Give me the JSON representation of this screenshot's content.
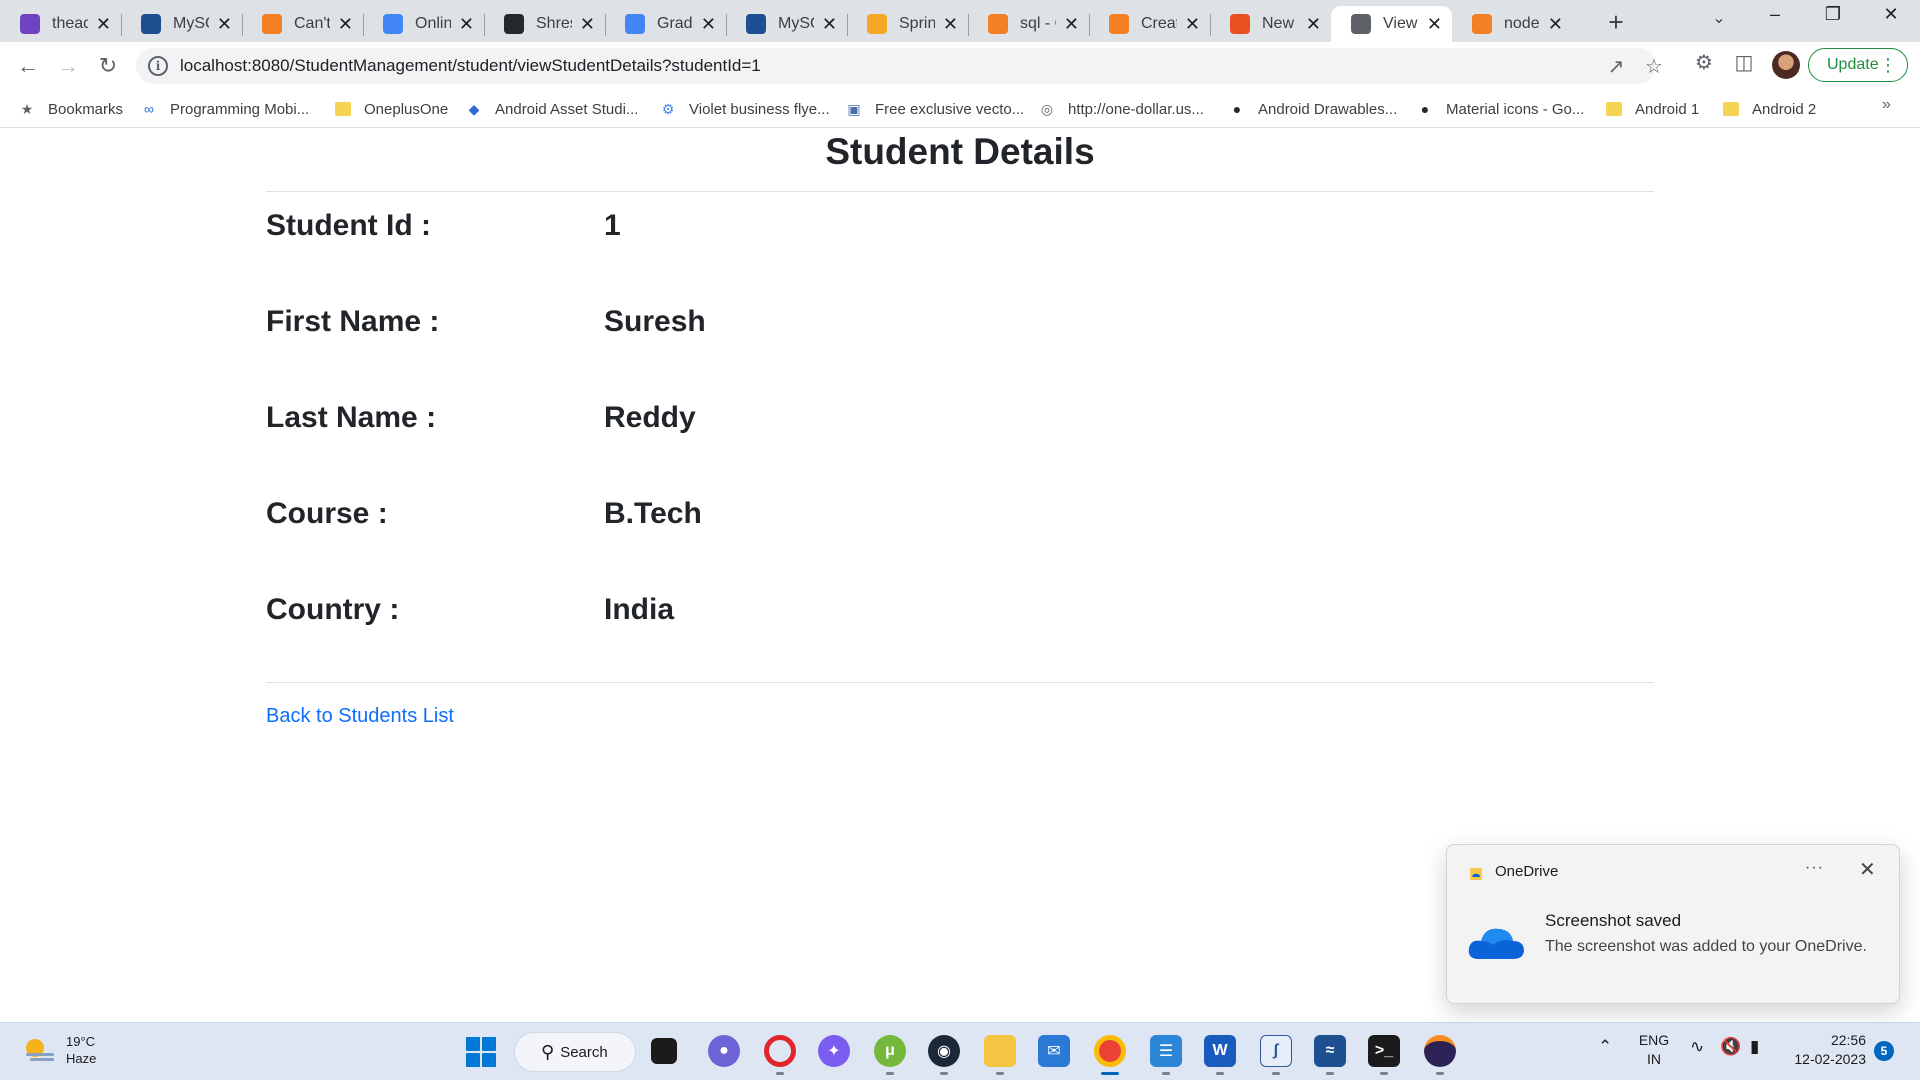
{
  "tabs": [
    {
      "title": "thead",
      "icon": "stack-icon",
      "color": "#6f42c1"
    },
    {
      "title": "MySQ",
      "icon": "mysql-workbench-icon",
      "color": "#1d4f91"
    },
    {
      "title": "Can't",
      "icon": "stackoverflow-icon",
      "color": "#f48024"
    },
    {
      "title": "Online",
      "icon": "google-icon",
      "color": "#4285f4"
    },
    {
      "title": "Shresh",
      "icon": "github-icon",
      "color": "#24292e"
    },
    {
      "title": "Grade",
      "icon": "google-icon",
      "color": "#4285f4"
    },
    {
      "title": "MySQ",
      "icon": "mysql-workbench-icon",
      "color": "#1d4f91"
    },
    {
      "title": "Spring",
      "icon": "code-icon",
      "color": "#f5a623"
    },
    {
      "title": "sql - C",
      "icon": "stackoverflow-icon",
      "color": "#f48024"
    },
    {
      "title": "Creati",
      "icon": "stackoverflow-icon",
      "color": "#f48024"
    },
    {
      "title": "New T",
      "icon": "brave-icon",
      "color": "#e8501d"
    },
    {
      "title": "View S",
      "icon": "globe-icon",
      "color": "#5f6368",
      "active": true
    },
    {
      "title": "node.j",
      "icon": "stackoverflow-icon",
      "color": "#f48024"
    }
  ],
  "address_bar": {
    "url": "localhost:8080/StudentManagement/student/viewStudentDetails?studentId=1"
  },
  "update_button": {
    "label": "Update"
  },
  "bookmarks": [
    {
      "label": "Bookmarks",
      "icon": "star-icon"
    },
    {
      "label": "Programming Mobi...",
      "icon": "infinity-icon"
    },
    {
      "label": "OneplusOne",
      "icon": "folder-icon"
    },
    {
      "label": "Android Asset Studi...",
      "icon": "android-studio-icon"
    },
    {
      "label": "Violet business flye...",
      "icon": "gear-icon"
    },
    {
      "label": "Free exclusive vecto...",
      "icon": "image-icon"
    },
    {
      "label": "http://one-dollar.us...",
      "icon": "globe-icon"
    },
    {
      "label": "Android Drawables...",
      "icon": "github-icon"
    },
    {
      "label": "Material icons - Go...",
      "icon": "github-icon"
    },
    {
      "label": "Android 1",
      "icon": "folder-icon"
    },
    {
      "label": "Android 2",
      "icon": "folder-icon"
    }
  ],
  "page": {
    "title": "Student Details",
    "fields": [
      {
        "label": "Student Id :",
        "value": "1"
      },
      {
        "label": "First Name :",
        "value": "Suresh"
      },
      {
        "label": "Last Name :",
        "value": "Reddy"
      },
      {
        "label": "Course :",
        "value": "B.Tech"
      },
      {
        "label": "Country :",
        "value": "India"
      }
    ],
    "back_link": "Back to Students List"
  },
  "toast": {
    "app_name": "OneDrive",
    "title": "Screenshot saved",
    "body": "The screenshot was added to your OneDrive."
  },
  "taskbar": {
    "weather_temp": "19°C",
    "weather_desc": "Haze",
    "search_label": "Search",
    "lang_top": "ENG",
    "lang_bottom": "IN",
    "time": "22:56",
    "date": "12-02-2023",
    "notifications": "5"
  }
}
